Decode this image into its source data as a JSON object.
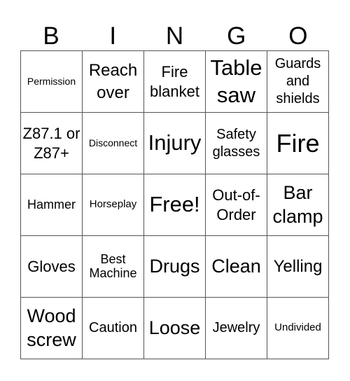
{
  "header": [
    "B",
    "I",
    "N",
    "G",
    "O"
  ],
  "cells": [
    [
      "Permission",
      "Reach over",
      "Fire blanket",
      "Table saw",
      "Guards and shields"
    ],
    [
      "Z87.1 or Z87+",
      "Disconnect",
      "Injury",
      "Safety glasses",
      "Fire"
    ],
    [
      "Hammer",
      "Horseplay",
      "Free!",
      "Out-of-Order",
      "Bar clamp"
    ],
    [
      "Gloves",
      "Best Machine",
      "Drugs",
      "Clean",
      "Yelling"
    ],
    [
      "Wood screw",
      "Caution",
      "Loose",
      "Jewelry",
      "Undivided"
    ]
  ],
  "colors": {
    "grid_line": "#555555",
    "text": "#000000",
    "background": "#ffffff"
  }
}
